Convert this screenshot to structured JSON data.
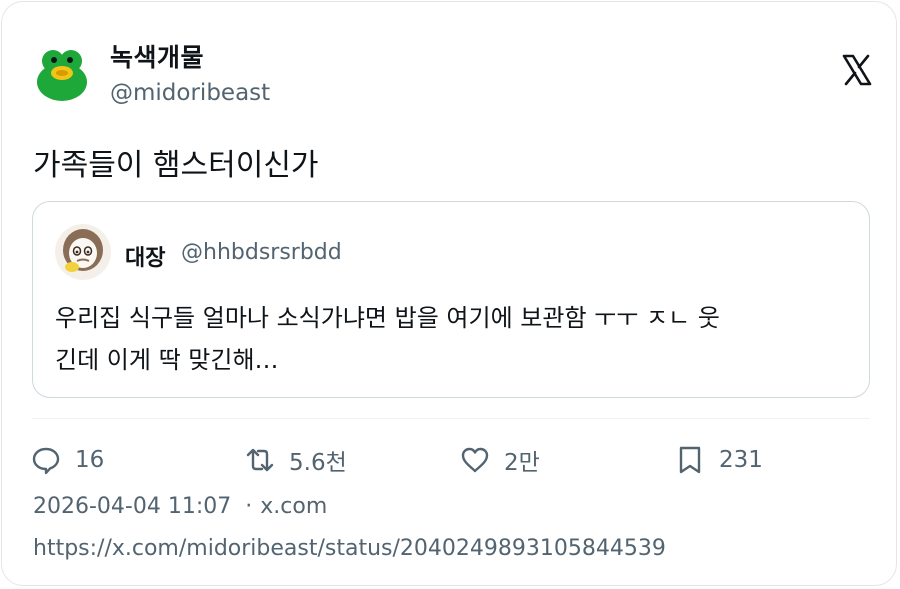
{
  "author": {
    "name": "녹색개물",
    "handle": "@midoribeast"
  },
  "tweet": {
    "text": "가족들이 햄스터이신가"
  },
  "quoted": {
    "name": "대장",
    "handle": "@hhbdsrsrbdd",
    "line1": "우리집 식구들 얼마나 소식가냐면 밥을 여기에 보관함 ㅜㅜ ㅈㄴ 웃",
    "line2": "긴데 이게 딱 맞긴해…"
  },
  "actions": {
    "replies": "16",
    "retweets": "5.6천",
    "likes": "2만",
    "bookmarks": "231"
  },
  "meta": {
    "timestamp": "2026-04-04 11:07",
    "separator": "·",
    "source": "x.com"
  },
  "link": "https://x.com/midoribeast/status/2040249893105844539",
  "icons": [
    "frog-avatar",
    "x-logo-icon",
    "user-avatar",
    "reply-icon",
    "retweet-icon",
    "like-icon",
    "bookmark-icon"
  ],
  "colors": {
    "text": "#0f1419",
    "muted": "#536471",
    "border": "#cfd9de",
    "avatar_green": "#1fa83a"
  }
}
